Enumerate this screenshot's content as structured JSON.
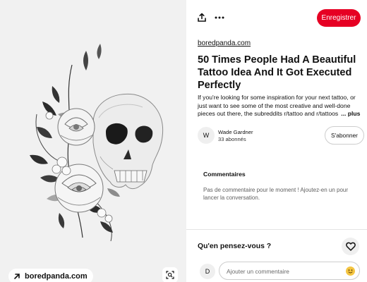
{
  "image_pane": {
    "source_chip_label": "boredpanda.com",
    "artwork_icon": "skull-and-roses-illustration",
    "lens_icon": "visual-search-icon"
  },
  "toolbar": {
    "share_icon": "share-icon",
    "more_icon": "more-dots-icon",
    "save_label": "Enregistrer",
    "save_color": "#e60023"
  },
  "pin": {
    "domain": "boredpanda.com",
    "title": "50 Times People Had A Beautiful Tattoo Idea And It Got Executed Perfectly",
    "description": "If you're looking for some inspiration for your next tattoo, or just want to see some of the most creative and well-done pieces out there, the subreddits r/tattoo and r/tattoos",
    "more_label": "... plus"
  },
  "author": {
    "initial": "W",
    "name": "Wade Gardner",
    "followers": "33 abonnés",
    "follow_label": "S'abonner"
  },
  "comments": {
    "title": "Commentaires",
    "empty_text": "Pas de commentaire pour le moment ! Ajoutez-en un pour lancer la conversation."
  },
  "feedback": {
    "prompt": "Qu'en pensez-vous ?",
    "react_icon": "heart-icon"
  },
  "composer": {
    "user_initial": "D",
    "placeholder": "Ajouter un commentaire",
    "emoji_icon": "emoji-icon"
  }
}
